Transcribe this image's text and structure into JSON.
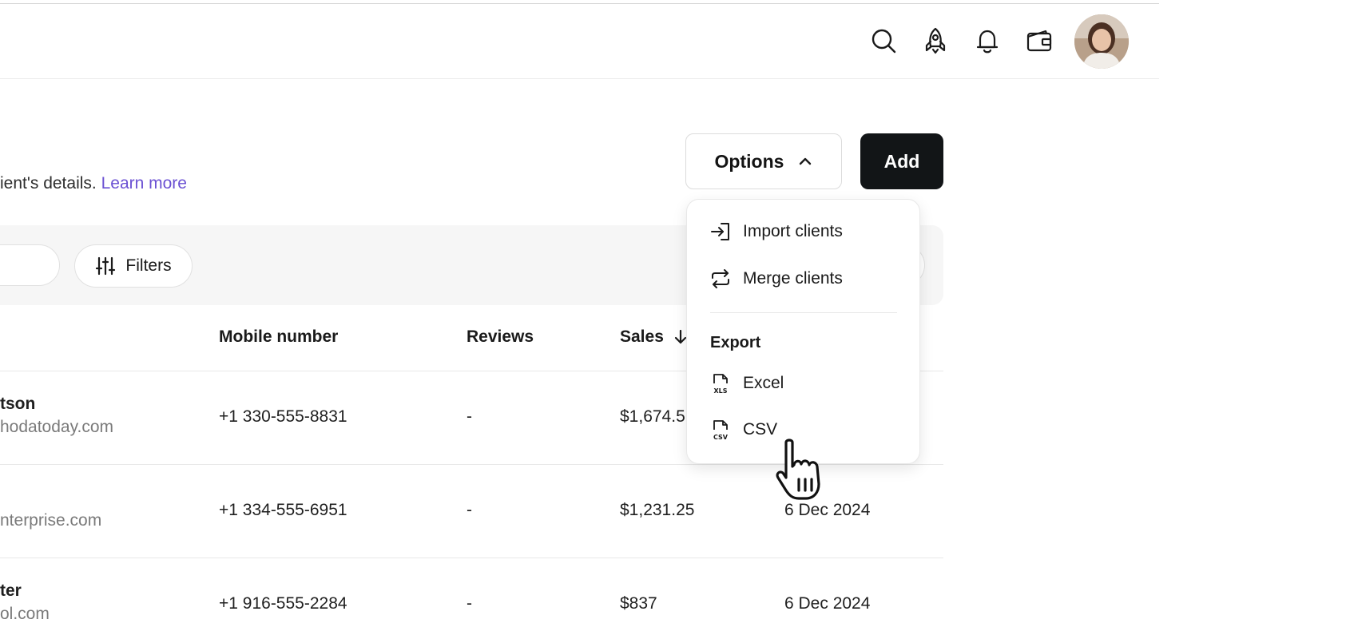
{
  "header": {
    "icons": [
      "search-icon",
      "rocket-icon",
      "bell-icon",
      "wallet-icon"
    ],
    "avatar": "user-avatar"
  },
  "page": {
    "subtitle": "ient's details.",
    "learn_more": "Learn more"
  },
  "actions": {
    "options_label": "Options",
    "add_label": "Add"
  },
  "toolbar": {
    "filters_label": "Filters"
  },
  "table": {
    "columns": {
      "mobile": "Mobile number",
      "reviews": "Reviews",
      "sales": "Sales"
    },
    "rows": [
      {
        "name": "tson",
        "email": "hodatoday.com",
        "mobile": "+1 330-555-8831",
        "reviews": "-",
        "sales": "$1,674.5",
        "date": ""
      },
      {
        "name": "",
        "email": "nterprise.com",
        "mobile": "+1 334-555-6951",
        "reviews": "-",
        "sales": "$1,231.25",
        "date": "6 Dec 2024"
      },
      {
        "name": "ter",
        "email": "ol.com",
        "mobile": "+1 916-555-2284",
        "reviews": "-",
        "sales": "$837",
        "date": "6 Dec 2024"
      }
    ]
  },
  "menu": {
    "import": "Import clients",
    "merge": "Merge clients",
    "export_heading": "Export",
    "excel": "Excel",
    "csv": "CSV"
  },
  "colors": {
    "accent_link": "#6b51d3",
    "primary_button": "#121517"
  }
}
